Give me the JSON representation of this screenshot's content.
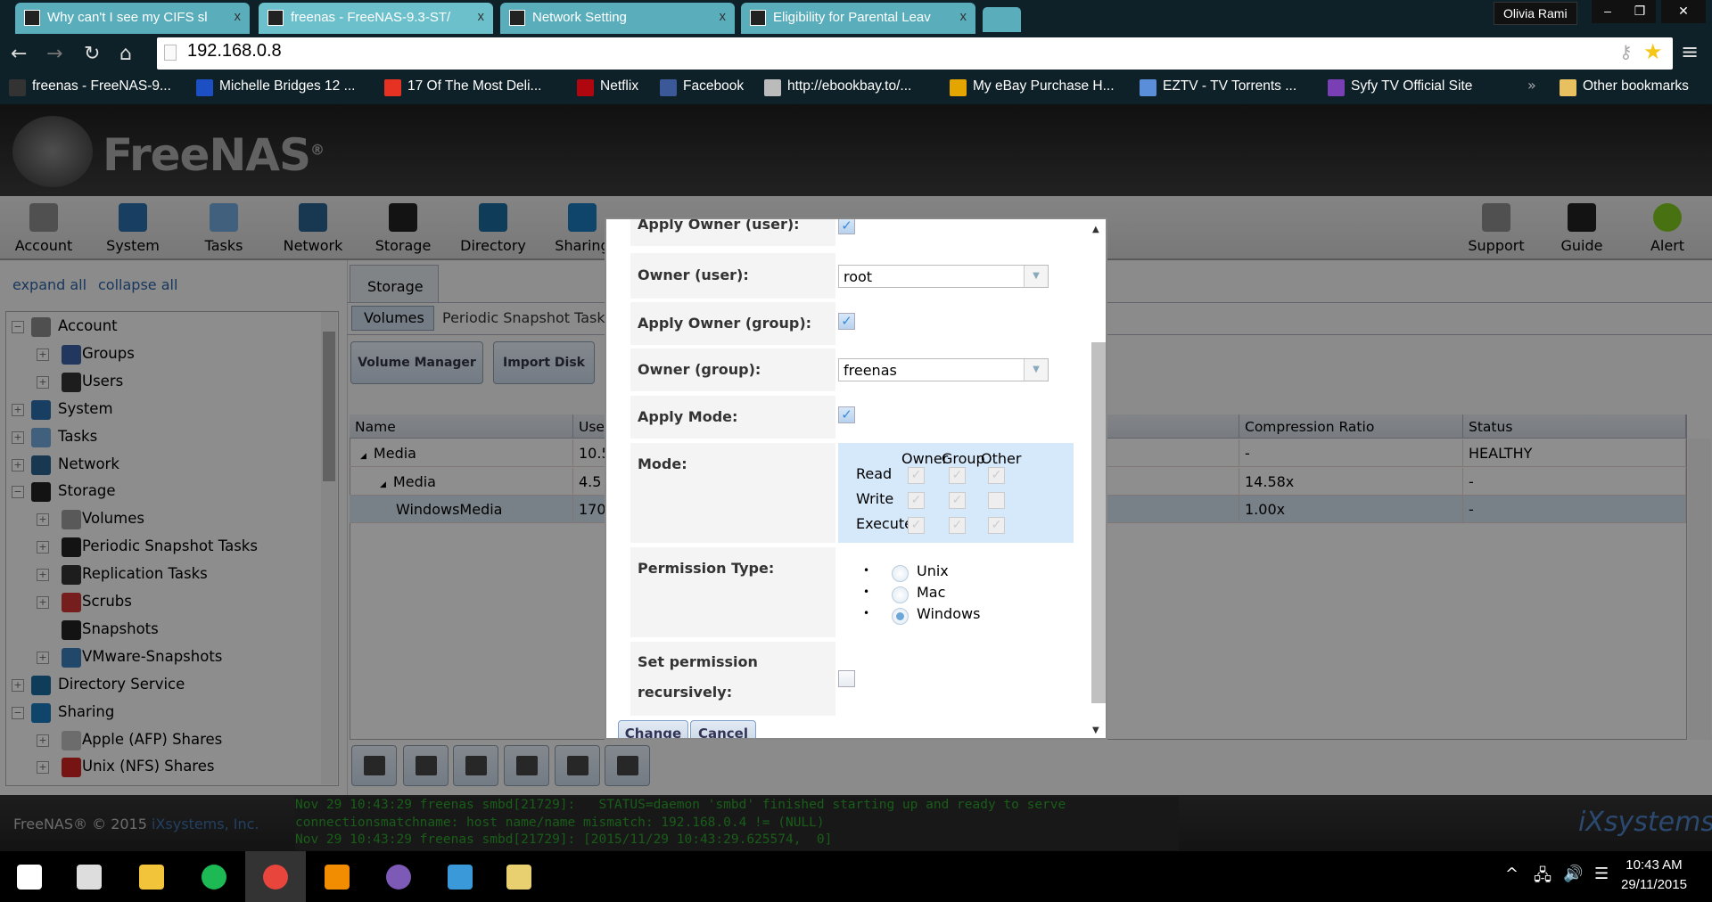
{
  "browser": {
    "tabs": [
      {
        "label": "Why can't I see my CIFS sl",
        "active": false
      },
      {
        "label": "freenas - FreeNAS-9.3-ST/",
        "active": true
      },
      {
        "label": "Network Setting",
        "active": false
      },
      {
        "label": "Eligibility for Parental Leav",
        "active": false
      }
    ],
    "close_glyph": "x",
    "profile": "Olivia Rami",
    "url": "192.168.0.8",
    "bookmarks": [
      {
        "label": "freenas - FreeNAS-9...",
        "color": "#333333"
      },
      {
        "label": "Michelle Bridges 12 ...",
        "color": "#1d4fc4"
      },
      {
        "label": "17 Of The Most Deli...",
        "color": "#e53222"
      },
      {
        "label": "Netflix",
        "color": "#b00610"
      },
      {
        "label": "Facebook",
        "color": "#3b5998"
      },
      {
        "label": "http://ebookbay.to/...",
        "color": "#bbbbbb"
      },
      {
        "label": "My eBay Purchase H...",
        "color": "#e5a500"
      },
      {
        "label": "EZTV - TV Torrents ...",
        "color": "#5a8ed8"
      },
      {
        "label": "Syfy TV Official Site",
        "color": "#7b3fb5"
      }
    ],
    "more_bookmarks": "»",
    "other_bookmarks": "Other bookmarks"
  },
  "app": {
    "logo_text": "FreeNAS",
    "logo_mark": "®",
    "toolbar": [
      {
        "label": "Account",
        "color": "#8a8a8a"
      },
      {
        "label": "System",
        "color": "#2a6ca8"
      },
      {
        "label": "Tasks",
        "color": "#6fa6d8"
      },
      {
        "label": "Network",
        "color": "#2a5f8a"
      },
      {
        "label": "Storage",
        "color": "#222222"
      },
      {
        "label": "Directory",
        "color": "#1a6a9a"
      },
      {
        "label": "Sharing",
        "color": "#1a78b8"
      }
    ],
    "toolbar_right": [
      {
        "label": "Support",
        "color": "#8a8a8a"
      },
      {
        "label": "Guide",
        "color": "#222222"
      },
      {
        "label": "Alert",
        "color": "#7cc520"
      }
    ],
    "expand_all": "expand all",
    "collapse_all": "collapse all",
    "tree": [
      {
        "label": "Account",
        "level": 0,
        "expander": "−",
        "color": "#888"
      },
      {
        "label": "Groups",
        "level": 1,
        "expander": "+",
        "color": "#3a5fa0"
      },
      {
        "label": "Users",
        "level": 1,
        "expander": "+",
        "color": "#333"
      },
      {
        "label": "System",
        "level": 0,
        "expander": "+",
        "color": "#2a6ca8"
      },
      {
        "label": "Tasks",
        "level": 0,
        "expander": "+",
        "color": "#6fa6d8"
      },
      {
        "label": "Network",
        "level": 0,
        "expander": "+",
        "color": "#2a5f8a"
      },
      {
        "label": "Storage",
        "level": 0,
        "expander": "−",
        "color": "#222"
      },
      {
        "label": "Volumes",
        "level": 1,
        "expander": "+",
        "color": "#999"
      },
      {
        "label": "Periodic Snapshot Tasks",
        "level": 1,
        "expander": "+",
        "color": "#222"
      },
      {
        "label": "Replication Tasks",
        "level": 1,
        "expander": "+",
        "color": "#333"
      },
      {
        "label": "Scrubs",
        "level": 1,
        "expander": "+",
        "color": "#c33"
      },
      {
        "label": "Snapshots",
        "level": 1,
        "expander": "",
        "color": "#222"
      },
      {
        "label": "VMware-Snapshots",
        "level": 1,
        "expander": "+",
        "color": "#3a7ab8"
      },
      {
        "label": "Directory Service",
        "level": 0,
        "expander": "+",
        "color": "#1a6a9a"
      },
      {
        "label": "Sharing",
        "level": 0,
        "expander": "−",
        "color": "#1a78b8"
      },
      {
        "label": "Apple (AFP) Shares",
        "level": 1,
        "expander": "+",
        "color": "#bbb"
      },
      {
        "label": "Unix (NFS) Shares",
        "level": 1,
        "expander": "+",
        "color": "#c22"
      }
    ],
    "storage_tab": "Storage",
    "subtabs": {
      "volumes": "Volumes",
      "periodic": "Periodic Snapshot Task"
    },
    "buttons": {
      "volume_manager": "Volume Manager",
      "import_disk": "Import Disk"
    },
    "grid": {
      "headers": {
        "name": "Name",
        "used": "Use",
        "compression": "Compression Ratio",
        "status": "Status"
      },
      "rows": [
        {
          "name": "Media",
          "used": "10.5",
          "compression": "-",
          "status": "HEALTHY",
          "indent": 0,
          "toggle": "◢"
        },
        {
          "name": "Media",
          "used": "4.5",
          "compression": "14.58x",
          "status": "-",
          "indent": 1,
          "toggle": "◢"
        },
        {
          "name": "WindowsMedia",
          "used": "170",
          "compression": "1.00x",
          "status": "-",
          "indent": 2,
          "toggle": ""
        }
      ]
    },
    "footer": {
      "copyright": "FreeNAS® © 2015",
      "company": "iXsystems, Inc.",
      "log": [
        "Nov 29 10:43:29 freenas smbd[21729]:   STATUS=daemon 'smbd' finished starting up and ready to serve",
        "connectionsmatchname: host name/name mismatch: 192.168.0.4 != (NULL)",
        "Nov 29 10:43:29 freenas smbd[21729]: [2015/11/29 10:43:29.625574,  0]"
      ],
      "brand": "iXsystems"
    }
  },
  "modal": {
    "apply_owner_user": {
      "label": "Apply Owner (user):",
      "checked": true
    },
    "owner_user": {
      "label": "Owner (user):",
      "value": "root"
    },
    "apply_owner_group": {
      "label": "Apply Owner (group):",
      "checked": true
    },
    "owner_group": {
      "label": "Owner (group):",
      "value": "freenas"
    },
    "apply_mode": {
      "label": "Apply Mode:",
      "checked": true
    },
    "mode": {
      "label": "Mode:",
      "columns": [
        "Owner",
        "Group",
        "Other"
      ],
      "rows": [
        {
          "label": "Read",
          "values": [
            true,
            true,
            true
          ]
        },
        {
          "label": "Write",
          "values": [
            true,
            true,
            false
          ]
        },
        {
          "label": "Execute",
          "values": [
            true,
            true,
            true
          ]
        }
      ]
    },
    "permission_type": {
      "label": "Permission Type:",
      "options": [
        "Unix",
        "Mac",
        "Windows"
      ],
      "selected": "Windows"
    },
    "recursive": {
      "label_line1": "Set permission",
      "label_line2": "recursively:",
      "checked": false
    },
    "change": "Change",
    "cancel": "Cancel"
  },
  "taskbar": {
    "apps": [
      {
        "name": "start",
        "color": "#ffffff"
      },
      {
        "name": "task-view",
        "color": "#dddddd"
      },
      {
        "name": "file-explorer",
        "color": "#f2c43a"
      },
      {
        "name": "spotify",
        "color": "#1db954"
      },
      {
        "name": "chrome",
        "color": "#e8453c"
      },
      {
        "name": "vlc",
        "color": "#f28c00"
      },
      {
        "name": "tor",
        "color": "#7d5ab5"
      },
      {
        "name": "control-panel",
        "color": "#3a9ad9"
      },
      {
        "name": "installer",
        "color": "#e8d070"
      }
    ],
    "time": "10:43 AM",
    "date": "29/11/2015"
  }
}
